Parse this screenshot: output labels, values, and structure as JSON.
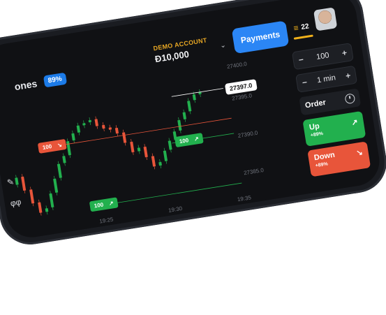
{
  "asset": {
    "name": "ones",
    "payout_badge": "89%"
  },
  "account": {
    "label": "DEMO ACCOUNT",
    "balance": "Ð10,000"
  },
  "payments_label": "Payments",
  "level": {
    "value": "22"
  },
  "price_axis": [
    "27400.0",
    "27395.0",
    "27390.0",
    "27385.0"
  ],
  "time_axis": [
    "19:25",
    "19:30",
    "19:35"
  ],
  "current_price": "27397.0",
  "trades": [
    {
      "amount": "100",
      "arrow": "↘",
      "direction": "down"
    },
    {
      "amount": "100",
      "arrow": "↗",
      "direction": "up"
    },
    {
      "amount": "100",
      "arrow": "↗",
      "direction": "up"
    }
  ],
  "panel": {
    "amount_value": "100",
    "time_value": "1 min",
    "minus": "−",
    "plus": "+",
    "order_label": "Order",
    "up_label": "Up",
    "up_payout": "+89%",
    "up_arrow": "↗",
    "down_label": "Down",
    "down_payout": "+89%",
    "down_arrow": "↘"
  },
  "colors": {
    "up": "#22b04e",
    "down": "#e8553a",
    "accent": "#2b86f5",
    "gold": "#f2b21b"
  },
  "icons": [
    "layers-icon",
    "pencil-icon",
    "indicator-icon",
    "clock-icon",
    "avatar"
  ]
}
